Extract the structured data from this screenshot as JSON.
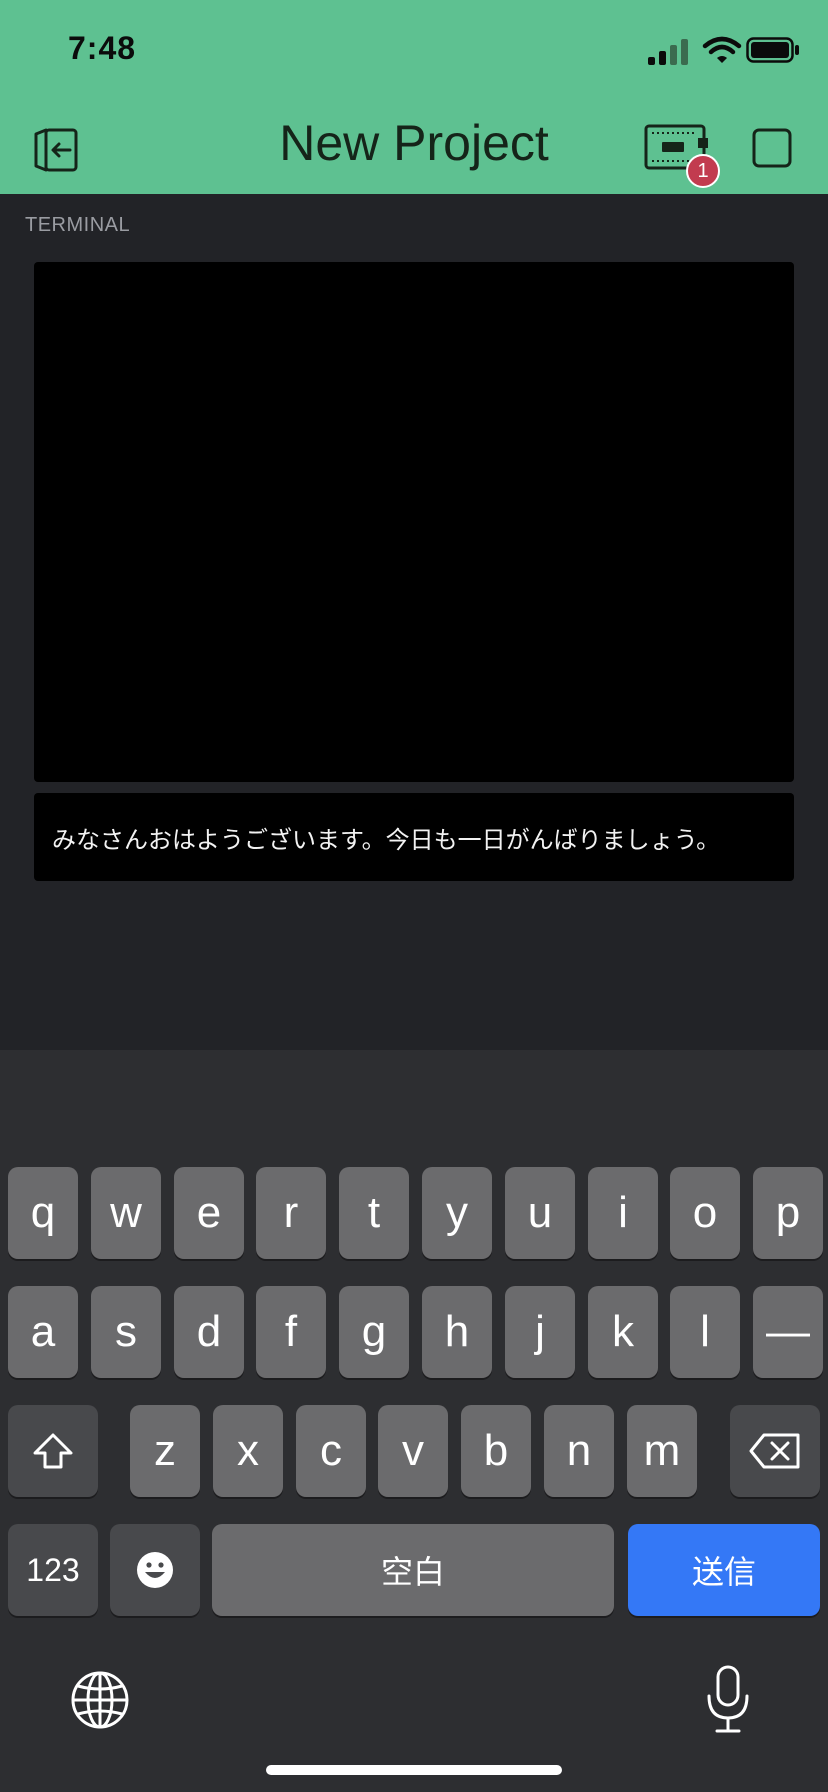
{
  "status_bar": {
    "time": "7:48"
  },
  "header": {
    "title": "New Project",
    "device_badge_count": "1"
  },
  "terminal": {
    "label": "TERMINAL",
    "input_text": "みなさんおはようございます。今日も一日がんばりましょう。"
  },
  "keyboard": {
    "row1": [
      "q",
      "w",
      "e",
      "r",
      "t",
      "y",
      "u",
      "i",
      "o",
      "p"
    ],
    "row2": [
      "a",
      "s",
      "d",
      "f",
      "g",
      "h",
      "j",
      "k",
      "l",
      "—"
    ],
    "row3": [
      "z",
      "x",
      "c",
      "v",
      "b",
      "n",
      "m"
    ],
    "numbers_label": "123",
    "space_label": "空白",
    "send_label": "送信"
  },
  "colors": {
    "header": "#5ec191",
    "background": "#222327",
    "send_key": "#3478f6",
    "badge": "#c23b4f"
  }
}
